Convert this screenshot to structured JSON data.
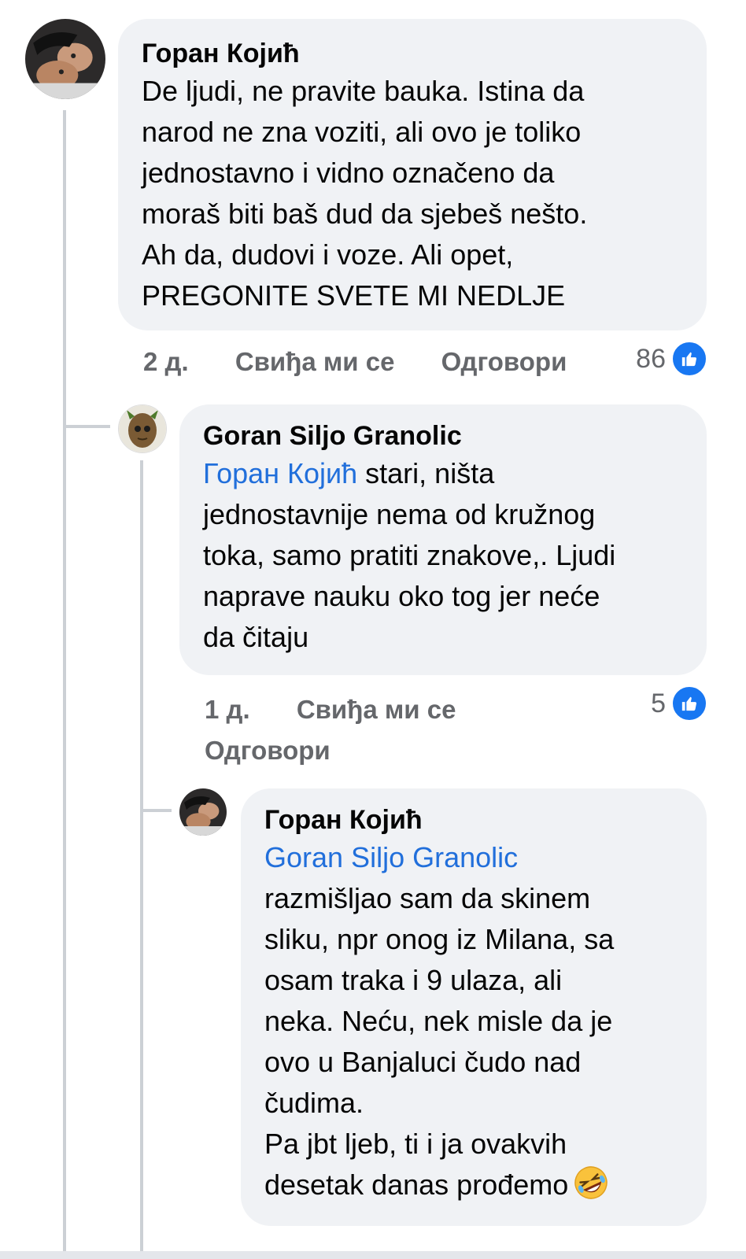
{
  "comments": [
    {
      "author": "Горан Којић",
      "text": "De ljudi, ne pravite bauka. Istina da\nnarod ne zna voziti, ali ovo je toliko\njednostavno i vidno označeno da\nmoraš biti baš dud da sjebeš nešto.\nAh da, dudovi i voze. Ali opet,\nPREGONITE SVETE MI NEDLJE",
      "time": "2 д.",
      "like_label": "Свиђа ми се",
      "reply_label": "Одговори",
      "likes": "86"
    },
    {
      "author": "Goran Siljo Granolic",
      "mention": "Горан Којић",
      "text": " stari, ništa\njednostavnije nema od kružnog\ntoka, samo pratiti znakove,. Ljudi\nnaprave nauku oko tog jer neće\nda čitaju",
      "time": "1 д.",
      "like_label": "Свиђа ми се",
      "reply_label": "Одговори",
      "likes": "5"
    },
    {
      "author": "Горан Којић",
      "mention": "Goran Siljo Granolic",
      "text": "\nrazmišljao sam da skinem\nsliku, npr onog iz Milana, sa\nosam traka i 9 ulaza, ali\nneka. Neću, nek misle da je\novo u Banjaluci čudo nad\nčudima.\nPa jbt ljeb, ti i ja ovakvih\ndesetak danas prođemo",
      "emoji": "rolling-on-floor-laughing-icon"
    }
  ],
  "colors": {
    "bubble": "#f0f2f5",
    "mention": "#216fdb",
    "meta": "#65676b",
    "like_badge": "#1877f2"
  }
}
